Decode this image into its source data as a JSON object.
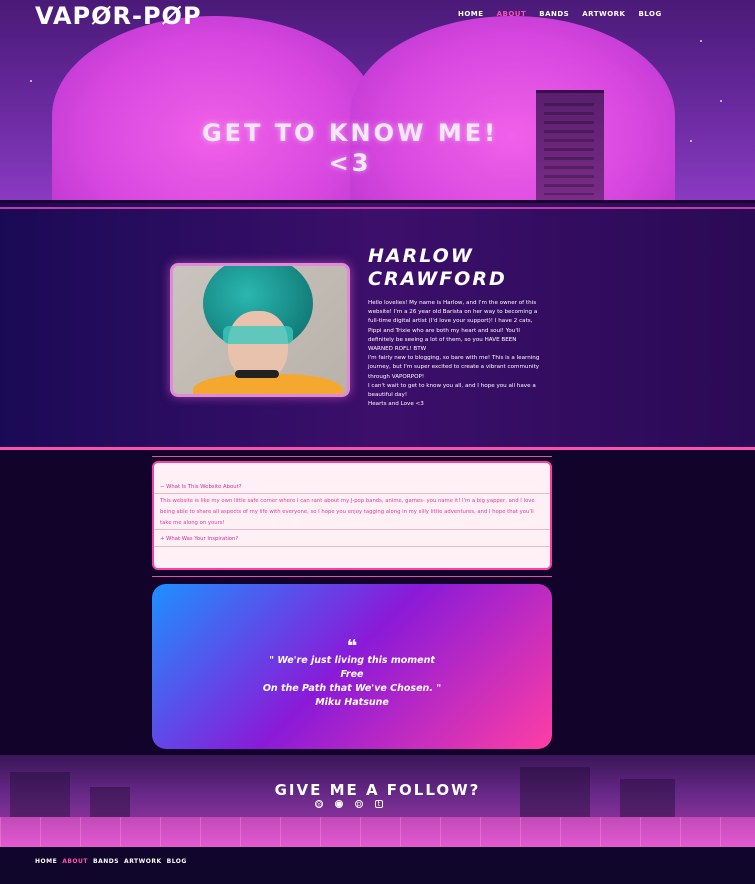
{
  "header": {
    "logo": "VAPØR-PØP",
    "nav": [
      {
        "label": "HOME",
        "active": false
      },
      {
        "label": "ABOUT",
        "active": true
      },
      {
        "label": "BANDS",
        "active": false
      },
      {
        "label": "ARTWORK",
        "active": false
      },
      {
        "label": "BLOG",
        "active": false
      }
    ]
  },
  "hero": {
    "title_line1": "GET TO KNOW ME!",
    "title_line2": "<3"
  },
  "about": {
    "name_line1": "HARLOW",
    "name_line2": "CRAWFORD",
    "bio": [
      "Hello lovelies! My name is Harlow, and I'm the owner of this website! I'm a 26 year old Barista on her way to becoming a full-time digital artist (I'd love your support)! I have 2 cats, Pippi and Trixie who are both my heart and soul! You'll definitely be seeing a lot of them, so you HAVE BEEN WARNED ROFL! BTW",
      "I'm fairly new to blogging, so bare with me! This is a learning journey, but I'm super excited to create a vibrant community through VAPORPOP!",
      "I can't wait to get to know you all, and I hope you all have a beautiful day!",
      "Hearts and Love <3"
    ]
  },
  "faq": {
    "q1": "What Is This Website About?",
    "q1_icon": "−",
    "a1": "This website is like my own little safe corner where I can rant about my J-pop bands, anime, games- you name it! I'm a big yapper, and I love being able to share all aspects of my life with everyone, so I hope you enjoy tagging along in my silly little adventures, and I hope that you'll take me along on yours!",
    "q2": "What Was Your Inspiration?",
    "q2_icon": "+"
  },
  "quote": {
    "mark": "❝",
    "line1": "\" We're just living this moment",
    "line2": "Free",
    "line3": "On the Path that We've Chosen. \"",
    "author": "Miku Hatsune"
  },
  "follow": {
    "title": "GIVE ME A FOLLOW?",
    "icons": [
      "instagram-icon",
      "discord-icon",
      "pinterest-icon",
      "tumblr-icon"
    ]
  },
  "footer": {
    "nav": [
      {
        "label": "HOME",
        "active": false
      },
      {
        "label": "ABOUT",
        "active": true
      },
      {
        "label": "BANDS",
        "active": false
      },
      {
        "label": "ARTWORK",
        "active": false
      },
      {
        "label": "BLOG",
        "active": false
      }
    ]
  },
  "colors": {
    "accent": "#ff4fb0",
    "arch": "#e050e0",
    "quote_start": "#1e90ff",
    "quote_end": "#ff3ea5"
  }
}
